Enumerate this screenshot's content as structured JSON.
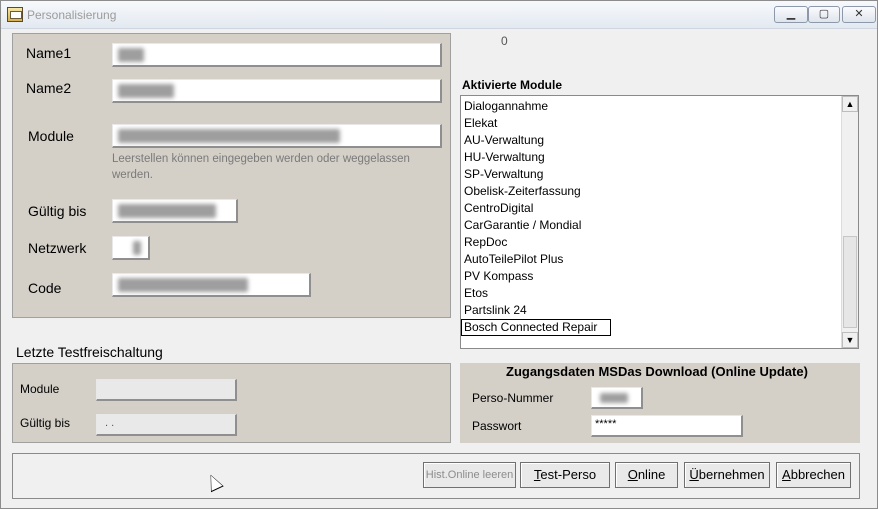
{
  "window": {
    "title": "Personalisierung"
  },
  "personal": {
    "name1_label": "Name1",
    "name2_label": "Name2",
    "module_label": "Module",
    "module_hint": "Leerstellen können eingegeben werden oder weggelassen werden.",
    "gueltig_label": "Gültig bis",
    "netzwerk_label": "Netzwerk",
    "code_label": "Code"
  },
  "module_count": "0",
  "modules": {
    "title": "Aktivierte Module",
    "items": [
      "Dialogannahme",
      "Elekat",
      "AU-Verwaltung",
      "HU-Verwaltung",
      "SP-Verwaltung",
      "Obelisk-Zeiterfassung",
      "CentroDigital",
      "CarGarantie / Mondial",
      "RepDoc",
      "AutoTeilePilot Plus",
      "PV Kompass",
      "Etos",
      "Partslink 24",
      "Bosch Connected Repair"
    ],
    "selected": "Bosch Connected Repair"
  },
  "test": {
    "title": "Letzte Testfreischaltung",
    "module_label": "Module",
    "gueltig_label": "Gültig bis",
    "gueltig_value": ". ."
  },
  "msdas": {
    "title": "Zugangsdaten MSDas Download (Online Update)",
    "perso_label": "Perso-Nummer",
    "pass_label": "Passwort",
    "pass_value": "*****"
  },
  "buttons": {
    "hist": "Hist.Online leeren",
    "test_perso_u": "T",
    "test_perso_rest": "est-Perso",
    "online_u": "O",
    "online_rest": "nline",
    "uebernehmen_u": "Ü",
    "uebernehmen_rest": "bernehmen",
    "abbrechen_u": "A",
    "abbrechen_rest": "bbrechen"
  },
  "colors": {
    "panel": "#d4d0c8",
    "window": "#f0f0f0"
  }
}
